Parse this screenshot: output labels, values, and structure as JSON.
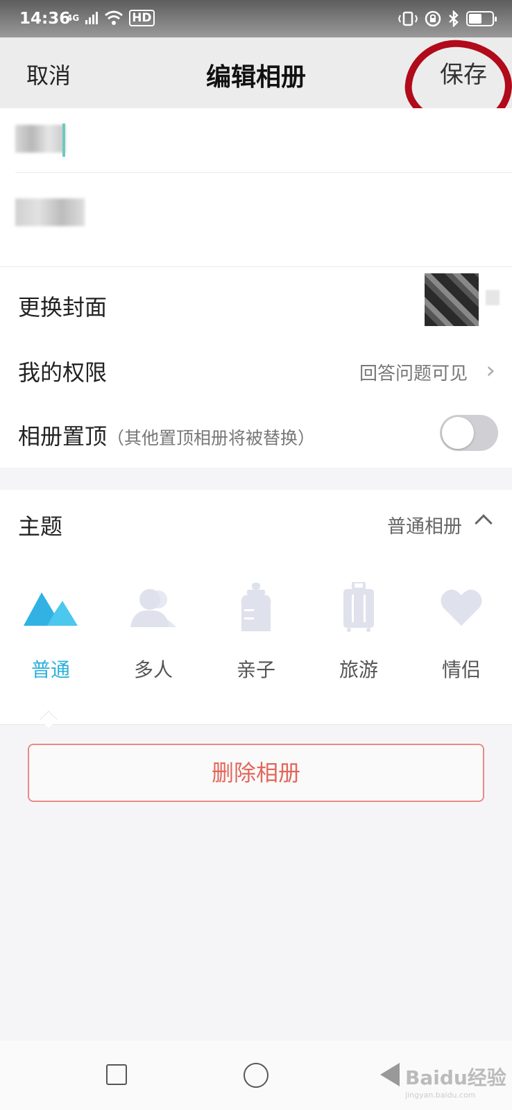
{
  "status_bar": {
    "time": "14:36",
    "network": "4G",
    "hd": "HD"
  },
  "nav": {
    "cancel": "取消",
    "title": "编辑相册",
    "save": "保存"
  },
  "settings": {
    "cover_label": "更换封面",
    "permission_label": "我的权限",
    "permission_value": "回答问题可见",
    "pin_label": "相册置顶",
    "pin_sub": "（其他置顶相册将被替换）",
    "pin_enabled": false
  },
  "theme": {
    "label": "主题",
    "value": "普通相册",
    "options": [
      {
        "label": "普通",
        "icon": "mountain-icon",
        "active": true
      },
      {
        "label": "多人",
        "icon": "people-icon",
        "active": false
      },
      {
        "label": "亲子",
        "icon": "baby-bottle-icon",
        "active": false
      },
      {
        "label": "旅游",
        "icon": "suitcase-icon",
        "active": false
      },
      {
        "label": "情侣",
        "icon": "heart-icon",
        "active": false
      }
    ]
  },
  "delete_label": "删除相册",
  "watermark": {
    "text": "Baidu经验",
    "sub": "jingyan.baidu.com"
  },
  "colors": {
    "accent": "#2bb0dc",
    "danger": "#e2675a",
    "annotation": "#b10a1a"
  }
}
